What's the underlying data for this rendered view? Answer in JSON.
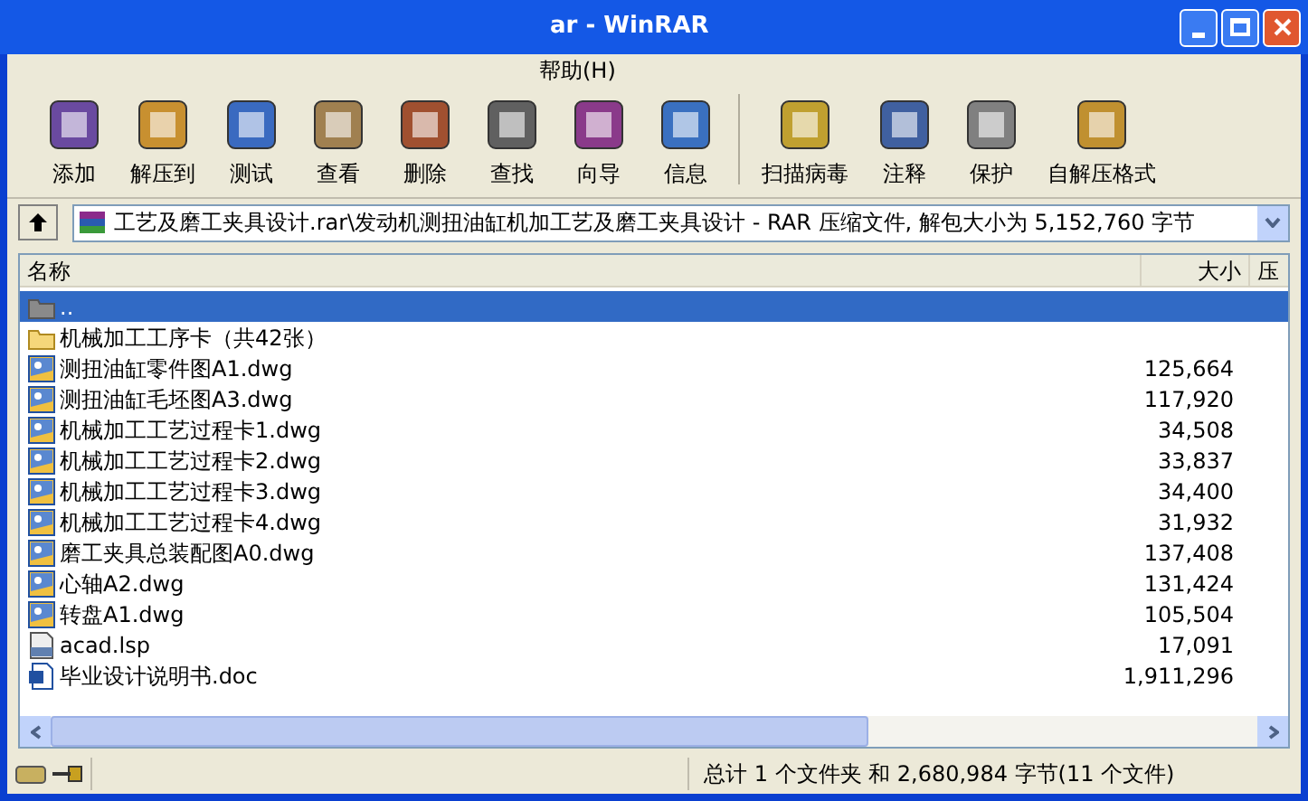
{
  "window": {
    "title": "ar - WinRAR"
  },
  "menu": [
    {
      "label": "帮助(H)"
    }
  ],
  "toolbar": [
    {
      "label": "添加"
    },
    {
      "label": "解压到"
    },
    {
      "label": "测试"
    },
    {
      "label": "查看"
    },
    {
      "label": "删除"
    },
    {
      "label": "查找"
    },
    {
      "label": "向导"
    },
    {
      "label": "信息"
    },
    {
      "label": "扫描病毒",
      "group_start": true
    },
    {
      "label": "注释"
    },
    {
      "label": "保护"
    },
    {
      "label": "自解压格式"
    }
  ],
  "address": {
    "value": "工艺及磨工夹具设计.rar\\发动机测扭油缸机加工艺及磨工夹具设计 - RAR 压缩文件, 解包大小为 5,152,760 字节"
  },
  "table": {
    "columns": [
      "名称",
      "大小",
      "压"
    ],
    "rows": [
      {
        "kind": "parent",
        "name": "..",
        "size": "",
        "selected": true
      },
      {
        "kind": "folder",
        "name": "机械加工工序卡（共42张）",
        "size": "",
        "selected": false
      },
      {
        "kind": "dwg",
        "name": "测扭油缸零件图A1.dwg",
        "size": "125,664",
        "selected": false
      },
      {
        "kind": "dwg",
        "name": "测扭油缸毛坯图A3.dwg",
        "size": "117,920",
        "selected": false
      },
      {
        "kind": "dwg",
        "name": "机械加工工艺过程卡1.dwg",
        "size": "34,508",
        "selected": false
      },
      {
        "kind": "dwg",
        "name": "机械加工工艺过程卡2.dwg",
        "size": "33,837",
        "selected": false
      },
      {
        "kind": "dwg",
        "name": "机械加工工艺过程卡3.dwg",
        "size": "34,400",
        "selected": false
      },
      {
        "kind": "dwg",
        "name": "机械加工工艺过程卡4.dwg",
        "size": "31,932",
        "selected": false
      },
      {
        "kind": "dwg",
        "name": "磨工夹具总装配图A0.dwg",
        "size": "137,408",
        "selected": false
      },
      {
        "kind": "dwg",
        "name": "心轴A2.dwg",
        "size": "131,424",
        "selected": false
      },
      {
        "kind": "dwg",
        "name": "转盘A1.dwg",
        "size": "105,504",
        "selected": false
      },
      {
        "kind": "lsp",
        "name": "acad.lsp",
        "size": "17,091",
        "selected": false
      },
      {
        "kind": "doc",
        "name": "毕业设计说明书.doc",
        "size": "1,911,296",
        "selected": false
      }
    ]
  },
  "status_bar": {
    "text": "总计 1 个文件夹 和 2,680,984 字节(11 个文件)"
  }
}
